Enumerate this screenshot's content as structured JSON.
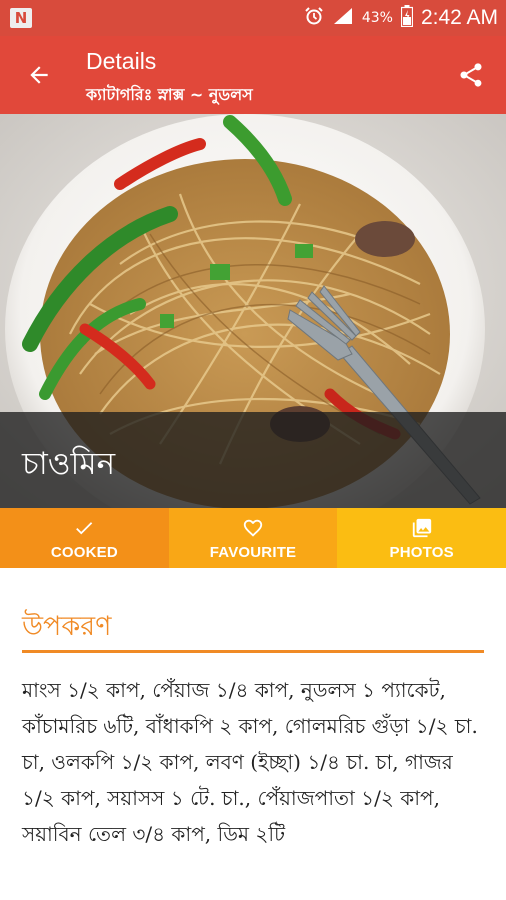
{
  "status_bar": {
    "notification_icon": "N",
    "battery_percent": "43%",
    "time": "2:42 AM",
    "icons": [
      "alarm-icon",
      "signal-icon",
      "battery-icon"
    ]
  },
  "app_bar": {
    "title": "Details",
    "subtitle": "ক্যাটাগরিঃ স্নাক্স ~ নুডলস",
    "back_icon": "arrow-back-icon",
    "share_icon": "share-icon"
  },
  "hero": {
    "dish_name": "চাওমিন"
  },
  "actions": [
    {
      "label": "COOKED",
      "icon": "check-icon",
      "color": "#f39018"
    },
    {
      "label": "FAVOURITE",
      "icon": "heart-icon",
      "color": "#f9a716"
    },
    {
      "label": "PHOTOS",
      "icon": "photos-icon",
      "color": "#fbbd12"
    }
  ],
  "ingredients": {
    "heading": "উপকরণ",
    "text": "মাংস ১/২ কাপ, পেঁয়াজ ১/৪ কাপ, নুডলস ১ প্যাকেট, কাঁচামরিচ ৬টি, বাঁধাকপি ২ কাপ, গোলমরিচ গুঁড়া ১/২ চা. চা, ওলকপি ১/২ কাপ, লবণ (ইচ্ছা) ১/৪ চা. চা, গাজর ১/২ কাপ, সয়াসস ১ টে. চা., পেঁয়াজপাতা ১/২ কাপ, সয়াবিন তেল ৩/৪ কাপ, ডিম ২টি"
  },
  "colors": {
    "status_bar": "#d84b3c",
    "app_bar": "#e1483a",
    "accent": "#f08a25"
  }
}
